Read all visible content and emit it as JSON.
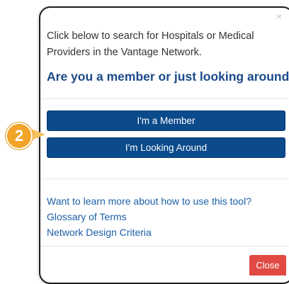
{
  "dialog": {
    "close_glyph": "×",
    "intro_text": "Click below to search for Hospitals or Medical Providers in the Vantage Network.",
    "heading": "Are you a member or just looking around?",
    "buttons": {
      "member": "I'm a Member",
      "looking": "I'm Looking Around"
    },
    "links": [
      "Want to learn more about how to use this tool?",
      "Glossary of Terms",
      "Network Design Criteria"
    ],
    "footer_close_label": "Close"
  },
  "callout": {
    "step_number": "2",
    "color": "#f1a427"
  },
  "colors": {
    "primary_button": "#0b4a8b",
    "heading": "#1a4a8a",
    "link": "#1c5fa8",
    "close_button": "#e04a43"
  }
}
